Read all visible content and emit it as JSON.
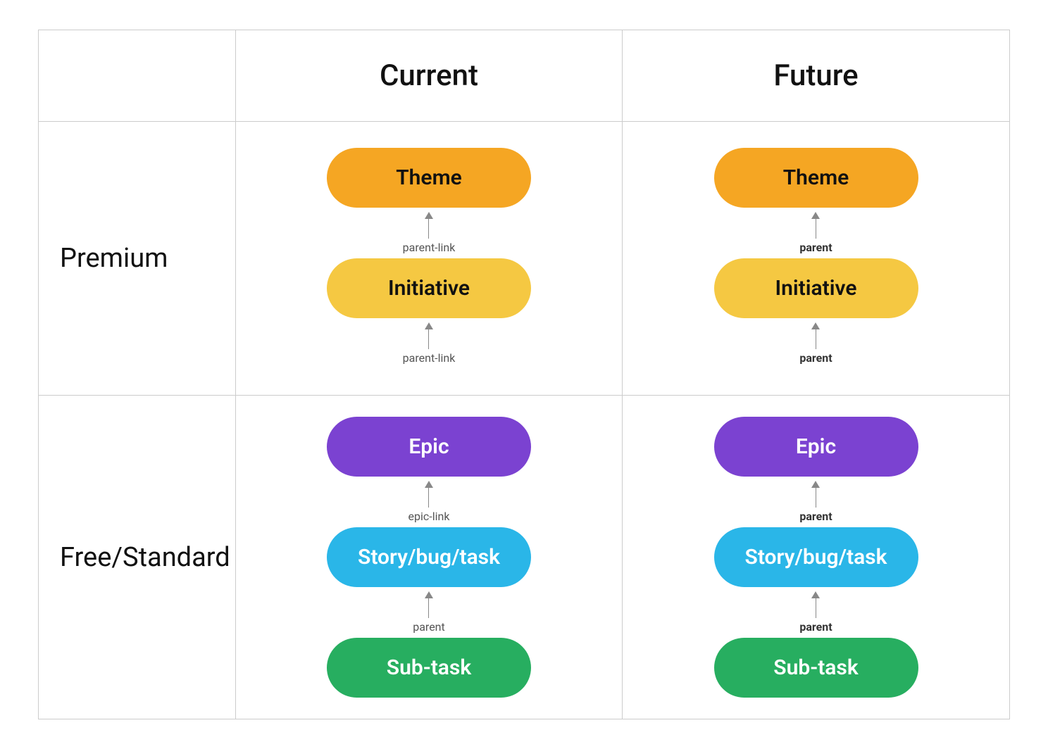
{
  "headers": {
    "empty": "",
    "current": "Current",
    "future": "Future"
  },
  "rows": {
    "premium_label": "Premium",
    "free_label": "Free/Standard"
  },
  "pills": {
    "theme": "Theme",
    "initiative": "Initiative",
    "epic": "Epic",
    "story": "Story/bug/task",
    "subtask": "Sub-task"
  },
  "connectors": {
    "parent_link": "parent-link",
    "epic_link": "epic-link",
    "parent": "parent",
    "parent_bold": "parent"
  }
}
